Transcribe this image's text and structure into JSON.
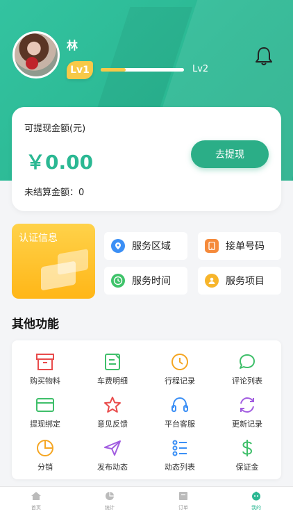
{
  "profile": {
    "name": "林",
    "level": "Lv1",
    "next_level": "Lv2",
    "level_progress": 0.3
  },
  "wallet": {
    "withdrawable_label": "可提现金额(元)",
    "amount": "￥0.00",
    "withdraw_button": "去提现",
    "pending_label": "未结算金额：0"
  },
  "auth_card": {
    "title": "认证信息"
  },
  "services": [
    {
      "label": "服务区域",
      "icon": "location-icon",
      "color": "#3b8ff5"
    },
    {
      "label": "接单号码",
      "icon": "phone-icon",
      "color": "#f58a3b"
    },
    {
      "label": "服务时间",
      "icon": "clock-icon",
      "color": "#3fc36a"
    },
    {
      "label": "服务项目",
      "icon": "user-icon",
      "color": "#f7b52b"
    }
  ],
  "other": {
    "title": "其他功能",
    "items": [
      {
        "label": "购买物料",
        "icon": "box-icon",
        "color": "#e94b4b"
      },
      {
        "label": "车费明细",
        "icon": "edit-doc-icon",
        "color": "#3fbf6a"
      },
      {
        "label": "行程记录",
        "icon": "clock-icon",
        "color": "#f5a623"
      },
      {
        "label": "评论列表",
        "icon": "chat-icon",
        "color": "#3fbf6a"
      },
      {
        "label": "提现绑定",
        "icon": "card-icon",
        "color": "#3fbf6a"
      },
      {
        "label": "意见反馈",
        "icon": "star-icon",
        "color": "#e94b4b"
      },
      {
        "label": "平台客服",
        "icon": "headset-icon",
        "color": "#3b8ff5"
      },
      {
        "label": "更新记录",
        "icon": "refresh-icon",
        "color": "#a25de0"
      },
      {
        "label": "分销",
        "icon": "pie-icon",
        "color": "#f5a623"
      },
      {
        "label": "发布动态",
        "icon": "send-icon",
        "color": "#a25de0"
      },
      {
        "label": "动态列表",
        "icon": "list-icon",
        "color": "#3b8ff5"
      },
      {
        "label": "保证金",
        "icon": "dollar-icon",
        "color": "#3fbf6a"
      }
    ]
  },
  "tabbar": {
    "items": [
      {
        "label": "首页",
        "icon": "home-icon"
      },
      {
        "label": "统计",
        "icon": "stats-icon"
      },
      {
        "label": "订单",
        "icon": "order-icon"
      },
      {
        "label": "我的",
        "icon": "profile-icon",
        "active": true
      }
    ]
  },
  "colors": {
    "brand": "#2bb893",
    "level": "#f7c948"
  }
}
